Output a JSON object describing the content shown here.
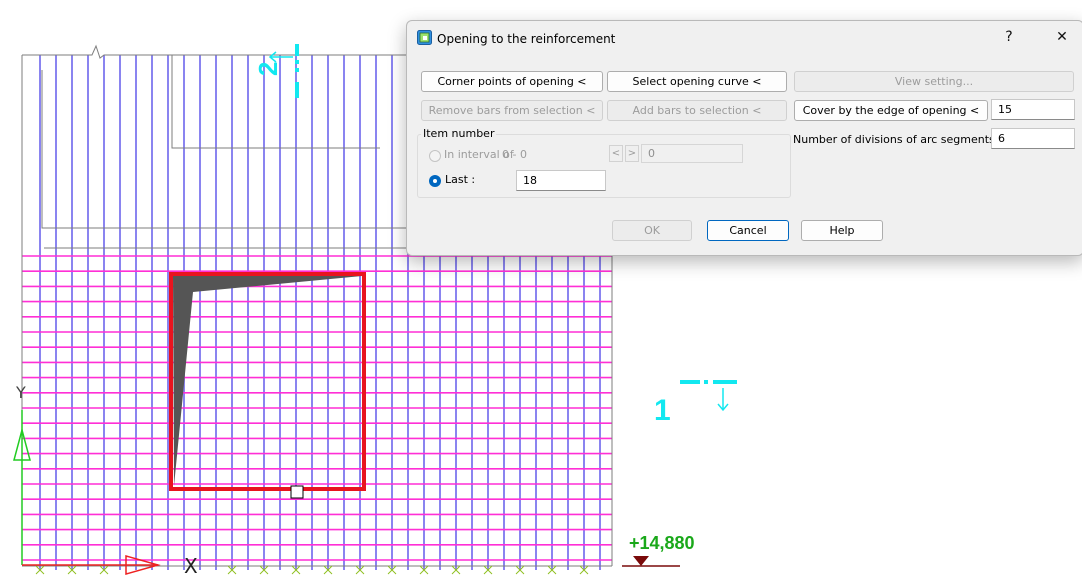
{
  "drawing": {
    "elevation_label": "+14,880",
    "section_1_label": "1",
    "section_2_label": "2",
    "axis_y_label": "Y",
    "axis_x_label": "X",
    "colors": {
      "rebar_vertical": "#8a84f0",
      "rebar_horizontal": "#ff2fd6",
      "opening_outline": "#e8141e",
      "section_marker": "#12e8f0",
      "elevation_text": "#1aa81a",
      "elevation_marker": "#7a0a0a",
      "outline": "#7e7e7e",
      "shaded_region": "#555555"
    }
  },
  "dialog": {
    "title": "Opening to the reinforcement",
    "help_glyph": "?",
    "close_glyph": "✕",
    "buttons": {
      "corner_points": "Corner points of opening <",
      "select_curve": "Select opening curve <",
      "view_setting": "View setting...",
      "remove_bars": "Remove bars from selection <",
      "add_bars": "Add bars to selection <",
      "cover_by_edge": "Cover by the edge of opening <",
      "ok": "OK",
      "cancel": "Cancel",
      "help": "Help"
    },
    "cover_value": "15",
    "arc_divisions_label": "Number of divisions of arc segments:",
    "arc_divisions_value": "6",
    "item_number": {
      "group_label": "Item number",
      "interval_label": "In interval of",
      "interval_range": "0 - 0",
      "prev_glyph": "<",
      "next_glyph": ">",
      "interval_value": "0",
      "last_label": "Last :",
      "last_value": "18",
      "selected_option": "Last"
    }
  }
}
